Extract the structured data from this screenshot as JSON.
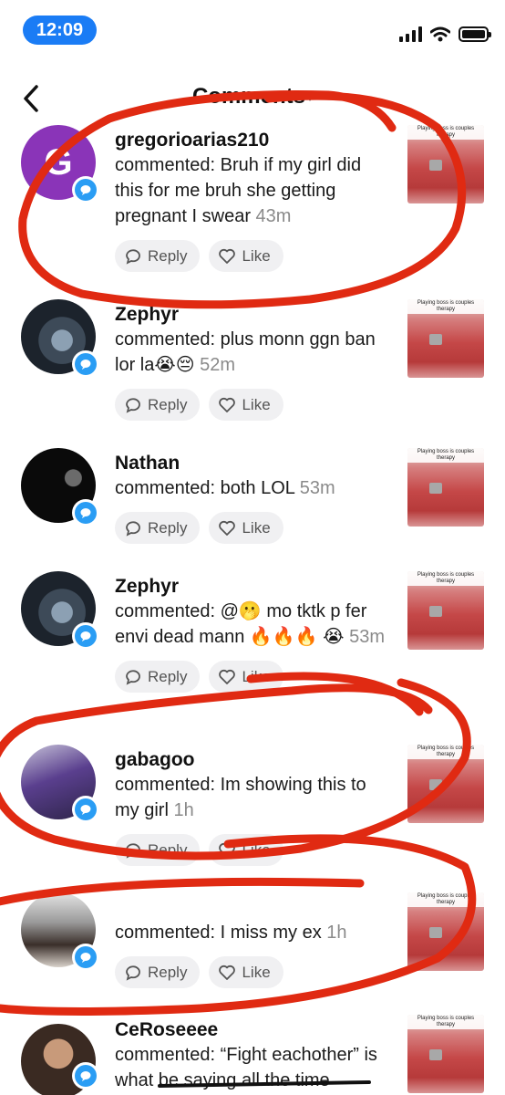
{
  "status_bar": {
    "time": "12:09"
  },
  "header": {
    "title": "Comments",
    "caret": "▾"
  },
  "actions": {
    "reply_label": "Reply",
    "like_label": "Like"
  },
  "thumbnail_caption": "Playing boss is couples therapy",
  "annotation_color": "#e02a12",
  "comments": [
    {
      "username": "gregorioarias210",
      "avatar_letter": "G",
      "text": "commented: Bruh if my girl did this for me bruh she getting pregnant I swear",
      "time": "43m"
    },
    {
      "username": "Zephyr",
      "text": "commented: plus monn ggn ban lor la😭😔",
      "time": "52m"
    },
    {
      "username": "Nathan",
      "text": "commented: both LOL",
      "time": "53m"
    },
    {
      "username": "Zephyr",
      "text": "commented: @🫢 mo tktk p fer envi dead mann 🔥🔥🔥 😭",
      "time": "53m"
    },
    {
      "username": "gabagoo",
      "text": "commented: Im showing this to my girl",
      "time": "1h"
    },
    {
      "username": "",
      "text": "commented: I miss my ex",
      "time": "1h"
    },
    {
      "username": "CeRoseeee",
      "text": "commented: “Fight eachother” is what be saying all the time",
      "time": ""
    }
  ]
}
